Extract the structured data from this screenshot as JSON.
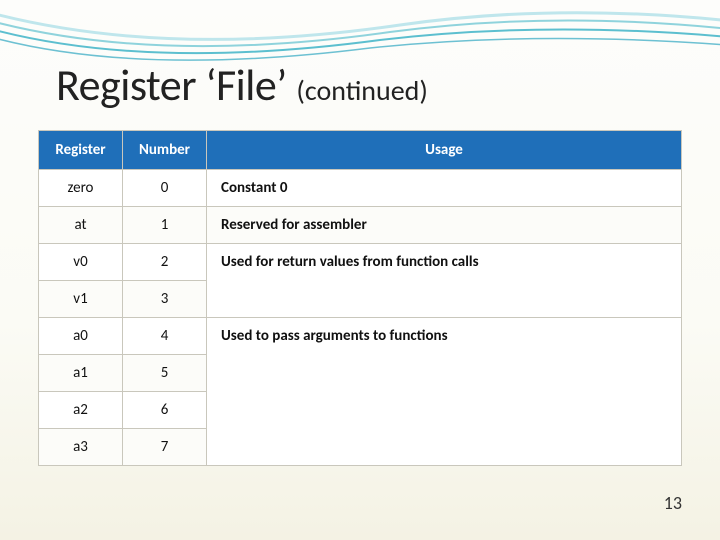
{
  "title": {
    "main": "Register ‘File’",
    "sub": "(continued)"
  },
  "headers": {
    "register": "Register",
    "number": "Number",
    "usage": "Usage"
  },
  "rows": [
    {
      "register": "zero",
      "number": "0",
      "usage": "Constant 0",
      "rowspan": 1
    },
    {
      "register": "at",
      "number": "1",
      "usage": "Reserved for assembler",
      "rowspan": 1
    },
    {
      "register": "v0",
      "number": "2",
      "usage": "Used for return values from function calls",
      "rowspan": 2
    },
    {
      "register": "v1",
      "number": "3"
    },
    {
      "register": "a0",
      "number": "4",
      "usage": "Used to pass arguments to functions",
      "rowspan": 4
    },
    {
      "register": "a1",
      "number": "5"
    },
    {
      "register": "a2",
      "number": "6"
    },
    {
      "register": "a3",
      "number": "7"
    }
  ],
  "page_number": "13"
}
